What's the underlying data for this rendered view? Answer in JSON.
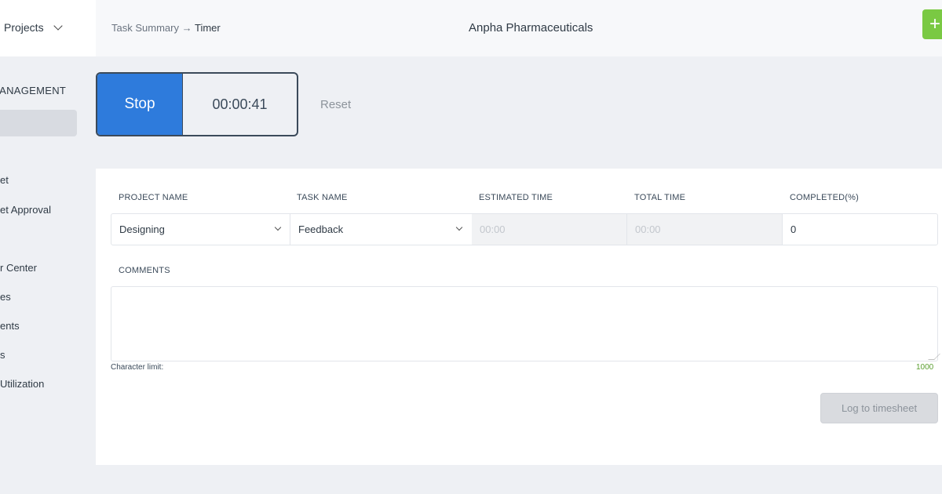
{
  "sidebar": {
    "projects_label": "Projects",
    "section_title": "MANAGEMENT",
    "items": [
      {
        "label": "et"
      },
      {
        "label": "et Approval"
      },
      {
        "label": "r Center"
      },
      {
        "label": "es"
      },
      {
        "label": "ents"
      },
      {
        "label": "s"
      },
      {
        "label": " Utilization"
      }
    ]
  },
  "header": {
    "breadcrumb_parent": "Task Summary",
    "breadcrumb_arrow": "→",
    "breadcrumb_current": "Timer",
    "company": "Anpha Pharmaceuticals",
    "add_icon": "+"
  },
  "timer": {
    "stop_label": "Stop",
    "elapsed": "00:00:41",
    "reset_label": "Reset"
  },
  "form": {
    "columns": {
      "project_name": "PROJECT NAME",
      "task_name": "TASK NAME",
      "estimated_time": "ESTIMATED TIME",
      "total_time": "TOTAL TIME",
      "completed": "COMPLETED(%)"
    },
    "values": {
      "project_name": "Designing",
      "task_name": "Feedback",
      "estimated_time_placeholder": "00:00",
      "total_time_placeholder": "00:00",
      "completed": "0"
    },
    "comments_label": "COMMENTS",
    "comments_value": "",
    "char_limit_label": "Character limit:",
    "char_limit_value": "1000",
    "log_button": "Log to timesheet"
  },
  "colors": {
    "stop_button": "#2e7bdc",
    "add_button": "#7ac943",
    "char_count": "#5a9e2f"
  }
}
